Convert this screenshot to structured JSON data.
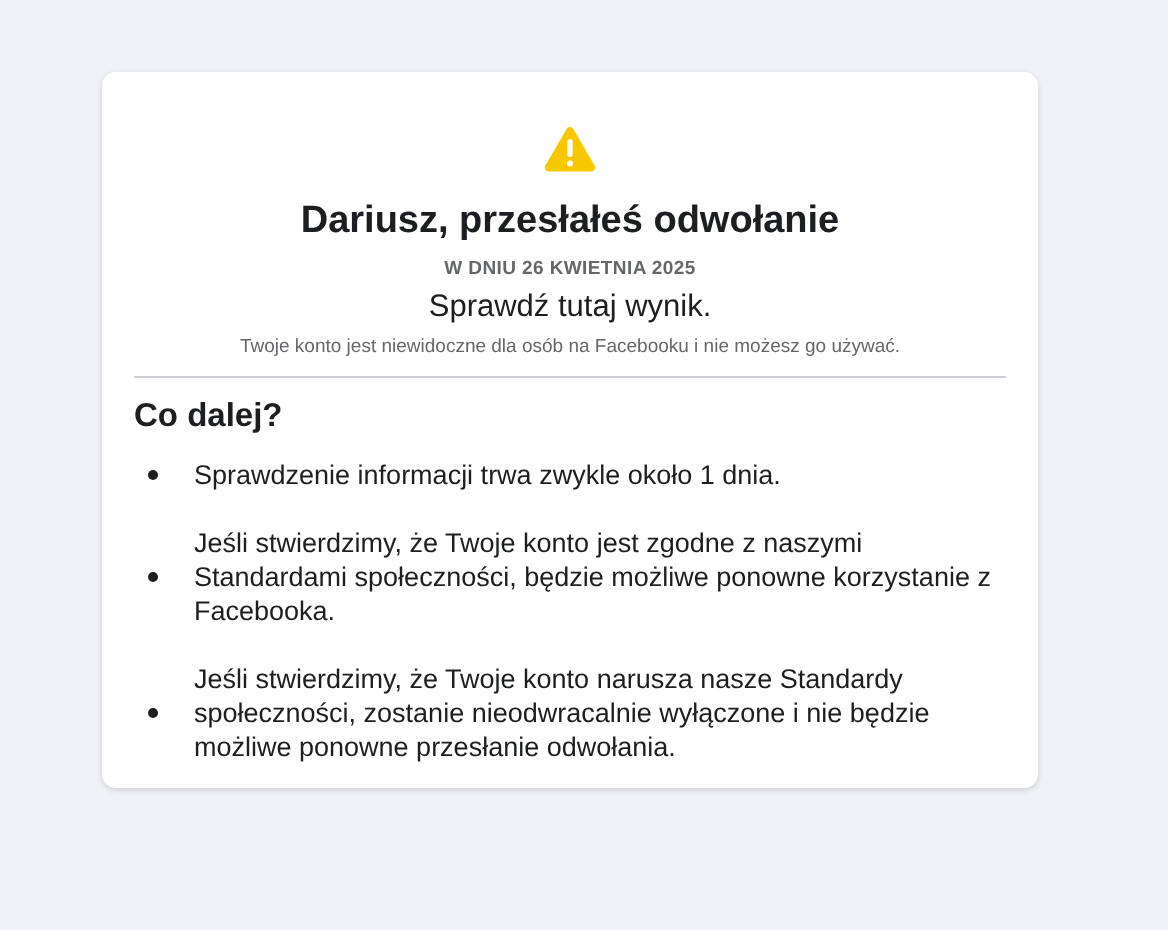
{
  "card": {
    "title": "Dariusz, przesłałeś odwołanie",
    "date": "W DNIU 26 KWIETNIA 2025",
    "subtitle": "Sprawdź tutaj wynik.",
    "notice": "Twoje konto jest niewidoczne dla osób na Facebooku i nie możesz go używać.",
    "section_heading": "Co dalej?",
    "items": [
      {
        "text": "Sprawdzenie informacji trwa zwykle około 1 dnia."
      },
      {
        "text": "Jeśli stwierdzimy, że Twoje konto jest zgodne z naszymi Standardami społeczności, będzie możliwe ponowne korzystanie z Facebooka."
      },
      {
        "text": "Jeśli stwierdzimy, że Twoje konto narusza nasze Standardy społeczności, zostanie nieodwracalnie wyłączone i nie będzie możliwe ponowne przesłanie odwołania."
      }
    ]
  }
}
